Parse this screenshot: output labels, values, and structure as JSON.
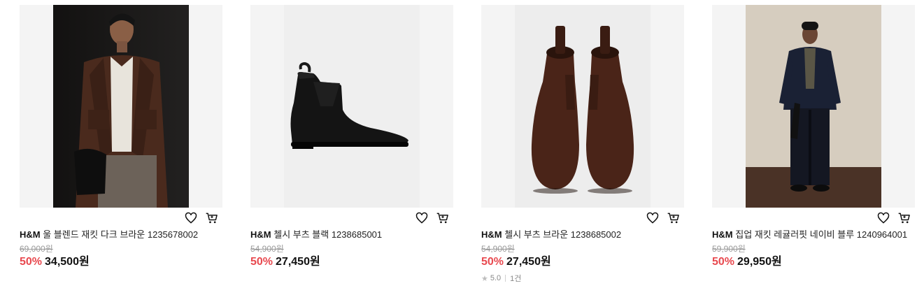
{
  "products": [
    {
      "brand": "H&M",
      "name": "울 블렌드 재킷 다크 브라운 1235678002",
      "original_price": "69,000원",
      "discount": "50%",
      "sale_price": "34,500원",
      "image": "model-in-dark-brown-jacket"
    },
    {
      "brand": "H&M",
      "name": "첼시 부츠 블랙 1238685001",
      "original_price": "54,900원",
      "discount": "50%",
      "sale_price": "27,450원",
      "image": "black-chelsea-boot"
    },
    {
      "brand": "H&M",
      "name": "첼시 부츠 브라운 1238685002",
      "original_price": "54,900원",
      "discount": "50%",
      "sale_price": "27,450원",
      "rating": "5.0",
      "review_count": "1건",
      "image": "brown-chelsea-boots-pair"
    },
    {
      "brand": "H&M",
      "name": "집업 재킷 레귤러핏 네이비 블루 1240964001",
      "original_price": "59,900원",
      "discount": "50%",
      "sale_price": "29,950원",
      "image": "model-in-navy-zip-jacket"
    }
  ],
  "icons": {
    "wishlist": "heart-icon",
    "cart": "cart-icon",
    "rating": "star-icon"
  },
  "colors": {
    "discount": "#e8494f",
    "text": "#111111",
    "muted": "#9a9a9a",
    "thumb_bg": "#f4f4f4"
  }
}
